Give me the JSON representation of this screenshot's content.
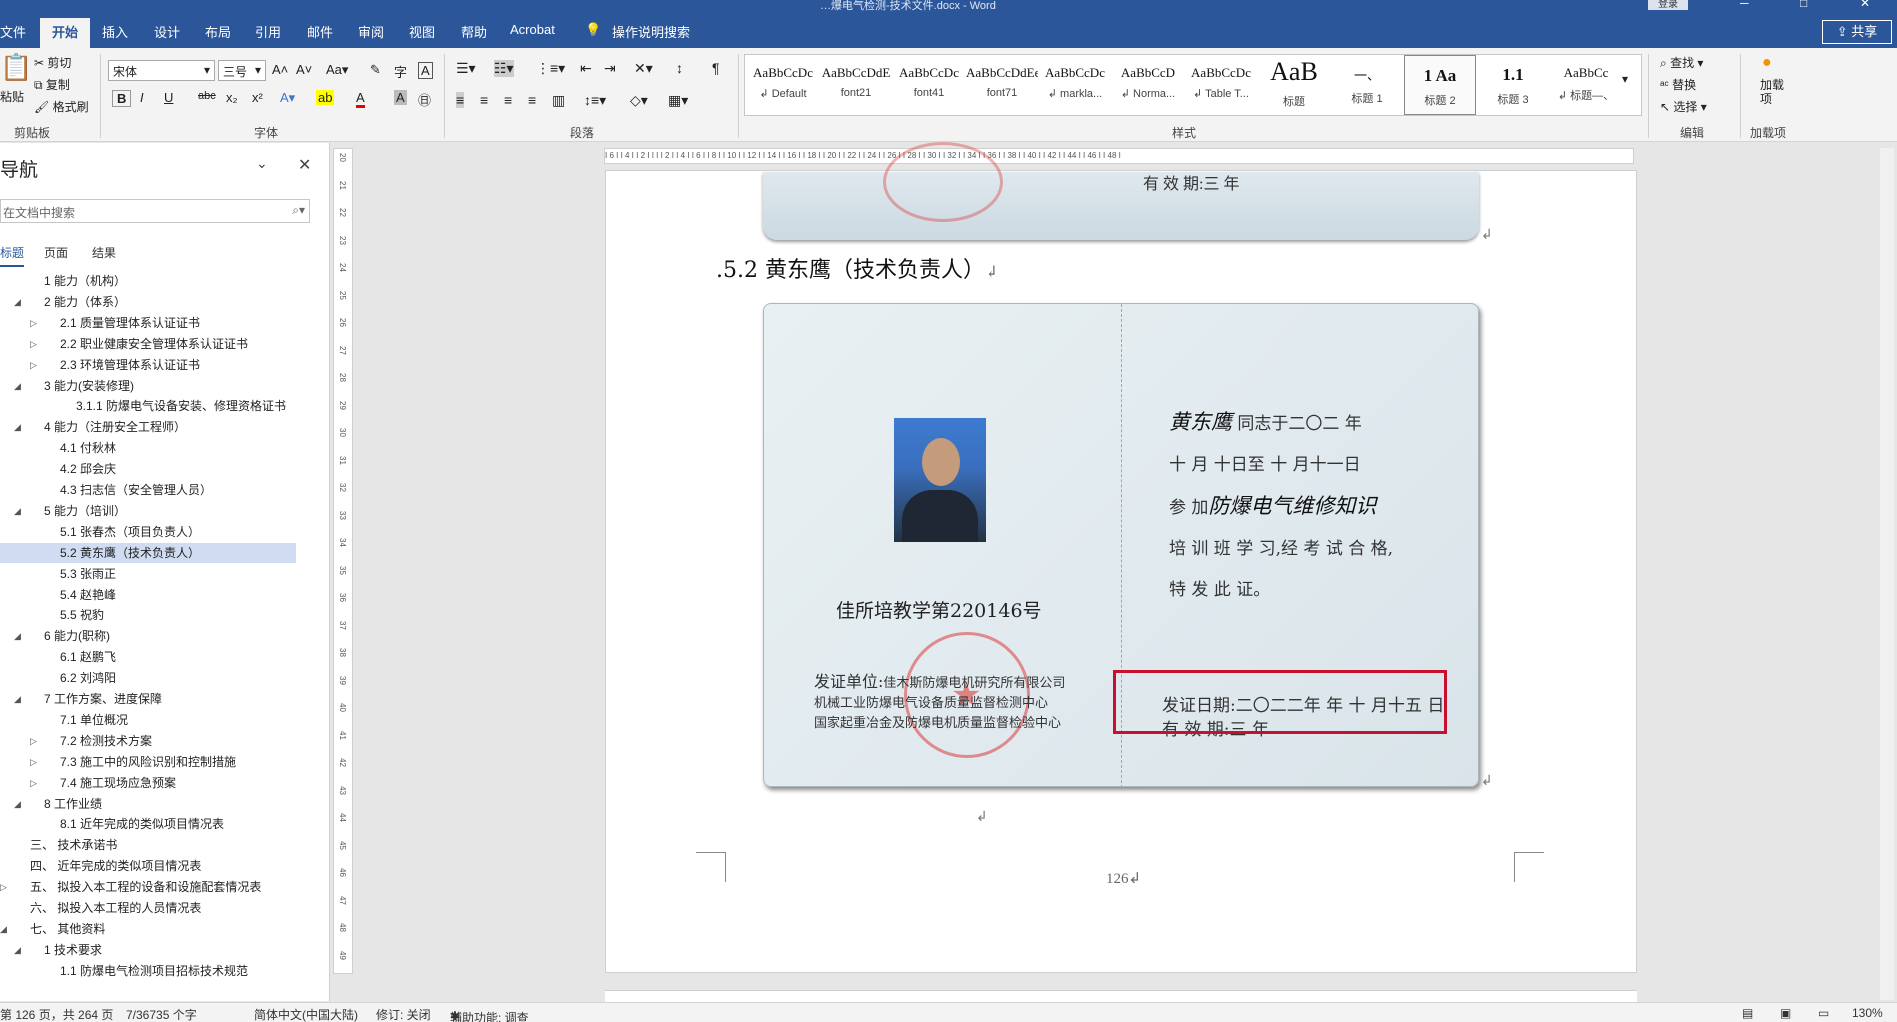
{
  "window": {
    "title": "…爆电气检测-技术文件.docx - Word",
    "login_label": "登录",
    "share_label": "共享"
  },
  "ribbon_tabs": [
    "文件",
    "开始",
    "插入",
    "设计",
    "布局",
    "引用",
    "邮件",
    "审阅",
    "视图",
    "帮助",
    "Acrobat",
    "操作说明搜索"
  ],
  "active_tab": "开始",
  "clipboard": {
    "paste": "粘贴",
    "cut": "剪切",
    "copy": "复制",
    "format_painter": "格式刷",
    "label": "剪贴板"
  },
  "font": {
    "name": "宋体",
    "size": "三号",
    "label": "字体",
    "bold": "B",
    "italic": "I",
    "underline": "U",
    "strike": "abc",
    "sub": "x₂",
    "sup": "x²"
  },
  "paragraph": {
    "label": "段落"
  },
  "styles": {
    "label": "样式",
    "items": [
      {
        "preview": "AaBbCcDc",
        "name": "↲ Default"
      },
      {
        "preview": "AaBbCcDdE",
        "name": "font21"
      },
      {
        "preview": "AaBbCcDc",
        "name": "font41"
      },
      {
        "preview": "AaBbCcDdEe",
        "name": "font71"
      },
      {
        "preview": "AaBbCcDc",
        "name": "↲ markla..."
      },
      {
        "preview": "AaBbCcD",
        "name": "↲ Norma..."
      },
      {
        "preview": "AaBbCcDc",
        "name": "↲ Table T..."
      },
      {
        "preview": "AaB",
        "name": "标题"
      },
      {
        "preview": "一、",
        "name": "标题 1"
      },
      {
        "preview": "1  Aa",
        "name": "标题 2"
      },
      {
        "preview": "1.1",
        "name": "标题 3"
      },
      {
        "preview": "AaBbCc",
        "name": "↲ 标题—、"
      }
    ]
  },
  "editing": {
    "find": "查找",
    "replace": "替换",
    "select": "选择",
    "label": "编辑"
  },
  "addins": {
    "add": "加载项",
    "label": "加载项"
  },
  "nav": {
    "title": "导航",
    "search_placeholder": "在文档中搜索",
    "tabs": [
      "标题",
      "页面",
      "结果"
    ],
    "items": [
      {
        "text": "1 能力（机构）",
        "level": 1,
        "arrow": ""
      },
      {
        "text": "2 能力（体系）",
        "level": 1,
        "arrow": "◢"
      },
      {
        "text": "2.1 质量管理体系认证证书",
        "level": 2,
        "arrow": "▷"
      },
      {
        "text": "2.2 职业健康安全管理体系认证证书",
        "level": 2,
        "arrow": "▷"
      },
      {
        "text": "2.3 环境管理体系认证证书",
        "level": 2,
        "arrow": "▷"
      },
      {
        "text": "3 能力(安装修理)",
        "level": 1,
        "arrow": "◢"
      },
      {
        "text": "3.1.1 防爆电气设备安装、修理资格证书",
        "level": 3,
        "arrow": ""
      },
      {
        "text": "4 能力（注册安全工程师）",
        "level": 1,
        "arrow": "◢"
      },
      {
        "text": "4.1 付秋林",
        "level": 2,
        "arrow": ""
      },
      {
        "text": "4.2 邱会庆",
        "level": 2,
        "arrow": ""
      },
      {
        "text": "4.3 扫志信（安全管理人员）",
        "level": 2,
        "arrow": ""
      },
      {
        "text": "5 能力（培训）",
        "level": 1,
        "arrow": "◢"
      },
      {
        "text": "5.1 张春杰（项目负责人）",
        "level": 2,
        "arrow": ""
      },
      {
        "text": "5.2 黄东鹰（技术负责人）",
        "level": 2,
        "arrow": "",
        "selected": true
      },
      {
        "text": "5.3 张雨正",
        "level": 2,
        "arrow": ""
      },
      {
        "text": "5.4 赵艳峰",
        "level": 2,
        "arrow": ""
      },
      {
        "text": "5.5 祝豹",
        "level": 2,
        "arrow": ""
      },
      {
        "text": "6 能力(职称)",
        "level": 1,
        "arrow": "◢"
      },
      {
        "text": "6.1 赵鹏飞",
        "level": 2,
        "arrow": ""
      },
      {
        "text": "6.2 刘鸿阳",
        "level": 2,
        "arrow": ""
      },
      {
        "text": "7 工作方案、进度保障",
        "level": 1,
        "arrow": "◢"
      },
      {
        "text": "7.1 单位概况",
        "level": 2,
        "arrow": ""
      },
      {
        "text": "7.2 检测技术方案",
        "level": 2,
        "arrow": "▷"
      },
      {
        "text": "7.3 施工中的风险识别和控制措施",
        "level": 2,
        "arrow": "▷"
      },
      {
        "text": "7.4 施工现场应急预案",
        "level": 2,
        "arrow": "▷"
      },
      {
        "text": "8 工作业绩",
        "level": 1,
        "arrow": "◢"
      },
      {
        "text": "8.1 近年完成的类似项目情况表",
        "level": 2,
        "arrow": ""
      },
      {
        "text": "三、 技术承诺书",
        "level": 0,
        "arrow": ""
      },
      {
        "text": "四、 近年完成的类似项目情况表",
        "level": 0,
        "arrow": ""
      },
      {
        "text": "五、 拟投入本工程的设备和设施配套情况表",
        "level": 0,
        "arrow": "▷"
      },
      {
        "text": "六、 拟投入本工程的人员情况表",
        "level": 0,
        "arrow": ""
      },
      {
        "text": "七、 其他资料",
        "level": 0,
        "arrow": "◢"
      },
      {
        "text": "1 技术要求",
        "level": 1,
        "arrow": "◢"
      },
      {
        "text": "1.1 防爆电气检测项目招标技术规范",
        "level": 2,
        "arrow": ""
      }
    ]
  },
  "document": {
    "top_cert_text": "有 效 期:三 年",
    "heading": ".5.2 黄东鹰（技术负责人）",
    "cert": {
      "number": "佳所培教学第220146号",
      "issuer_label": "发证单位:",
      "issuer_lines": [
        "佳木斯防爆电机研究所有限公司",
        "机械工业防爆电气设备质量监督检测中心",
        "国家起重冶金及防爆电机质量监督检验中心"
      ],
      "line1_hand": "黄东鹰",
      "line1": " 同志于二〇二   年",
      "line2": "十 月 十日至 十 月十一日",
      "line3_pre": "参 加",
      "line3_hand": "防爆电气维修知识",
      "line4": "培 训 班 学 习,经 考 试 合 格,",
      "line5": "特 发 此 证。",
      "date_line": "发证日期:二〇二二年 年 十 月十五 日",
      "valid_line": "有 效 期:三 年"
    },
    "page_number": "126↲"
  },
  "status": {
    "page": "第 126 页，共 264 页",
    "words": "7/36735 个字",
    "lang": "简体中文(中国大陆)",
    "track": "修订: 关闭",
    "access": "辅助功能: 调查",
    "zoom": "130%"
  }
}
